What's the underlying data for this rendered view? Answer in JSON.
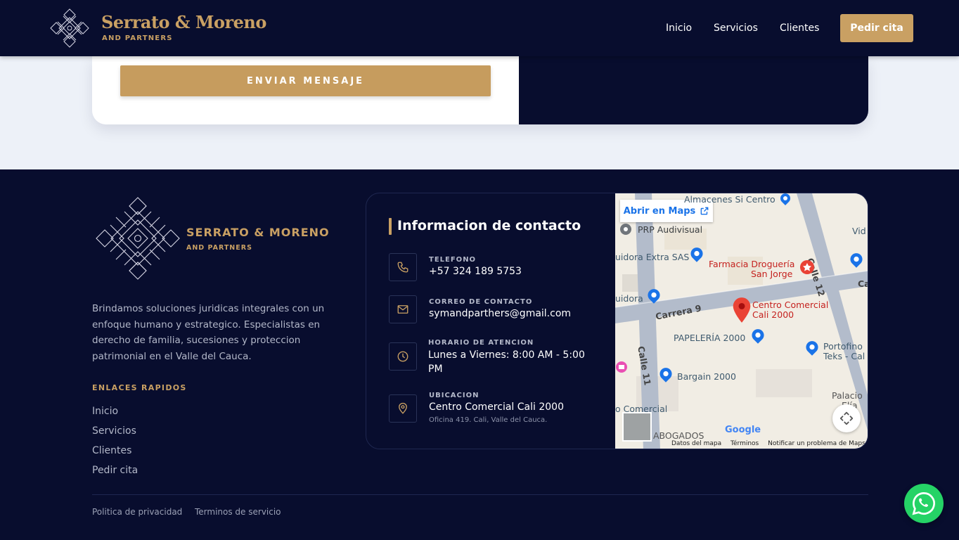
{
  "header": {
    "brand_name": "Serrato & Moreno",
    "brand_sub": "AND PARTNERS",
    "nav": [
      "Inicio",
      "Servicios",
      "Clientes"
    ],
    "cta": "Pedir cita"
  },
  "form": {
    "send_label": "ENVIAR MENSAJE"
  },
  "footer": {
    "brand_name": "SERRATO & MORENO",
    "brand_sub": "AND PARTNERS",
    "description": "Brindamos soluciones juridicas integrales con un enfoque humano y estrategico. Especialistas en derecho de familia, sucesiones y proteccion patrimonial en el Valle del Cauca.",
    "links_title": "ENLACES RAPIDOS",
    "links": [
      "Inicio",
      "Servicios",
      "Clientes",
      "Pedir cita"
    ],
    "legal": [
      "Politica de privacidad",
      "Terminos de servicio"
    ]
  },
  "contact": {
    "title": "Informacion de contacto",
    "items": [
      {
        "label": "TELEFONO",
        "value": "+57 324 189 5753",
        "icon": "phone-icon"
      },
      {
        "label": "CORREO DE CONTACTO",
        "value": "symandparthers@gmail.com",
        "icon": "mail-icon"
      },
      {
        "label": "HORARIO DE ATENCION",
        "value": "Lunes a Viernes: 8:00 AM - 5:00 PM",
        "icon": "clock-icon"
      },
      {
        "label": "UBICACION",
        "value": "Centro Comercial Cali 2000",
        "sub": "Oficina 419. Cali, Valle del Cauca.",
        "icon": "location-pin-icon"
      }
    ]
  },
  "map": {
    "open_label": "Abrir en Maps",
    "labels": {
      "almacenes": "Almacenes Si Centro",
      "prp": "PRP Audivisual",
      "uidora_extra": "uidora Extra SAS",
      "farmacia_1": "Farmacia Droguería",
      "farmacia_2": "San Jorge",
      "calle12": "Calle 12",
      "uidora": "uidora",
      "carrera9": "Carrera 9",
      "centro_1": "Centro Comercial",
      "centro_2": "Cali 2000",
      "papeleria": "PAPELERÍA 2000",
      "calle11": "Calle 11",
      "portofino_1": "Portofino",
      "portofino_2": "Teks - Cal",
      "bargain": "Bargain 2000",
      "palacio_1": "Palacio",
      "palacio_2": "Elía",
      "comercial": "o Comercial",
      "abogados": "ABOGADOS",
      "vid": "Vid",
      "ca": "Ca",
      "google": "Google"
    },
    "footer_links": [
      "Datos del mapa",
      "Términos",
      "Notificar un problema de Maps"
    ]
  },
  "colors": {
    "navy": "#080d2e",
    "gold": "#c9a063",
    "light_bg": "#edf1f8",
    "whatsapp": "#25d366"
  }
}
